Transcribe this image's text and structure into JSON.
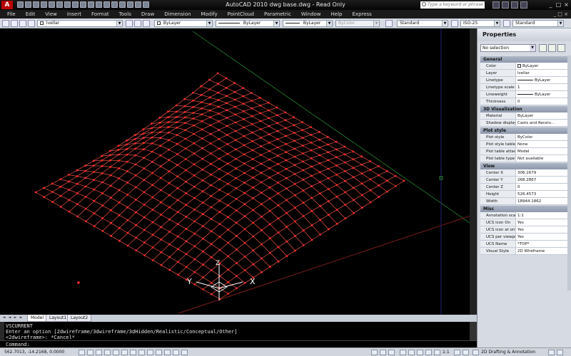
{
  "titlebar": {
    "title": "AutoCAD 2010    dwg base.dwg - Read Only",
    "search_placeholder": "Type a keyword or phrase",
    "app_logo": "A",
    "win_controls": [
      "_",
      "□",
      "×"
    ]
  },
  "menu": {
    "items": [
      "File",
      "Edit",
      "View",
      "Insert",
      "Format",
      "Tools",
      "Draw",
      "Dimension",
      "Modify",
      "PointCloud",
      "Parametric",
      "Window",
      "Help",
      "Express"
    ],
    "mini_controls": "_ □ ×"
  },
  "toolbar": {
    "layer": "lvellar",
    "color": "ByLayer",
    "linetype": "ByLayer",
    "lineweight": "ByLayer",
    "plotstyle": "ByColor",
    "text_style": "Standard",
    "dim_style": "ISO-25",
    "table_style": "Standard"
  },
  "tabs": {
    "nav": [
      "◄",
      "◄",
      "►",
      "►"
    ],
    "items": [
      "Model",
      "Layout1",
      "Layout2"
    ],
    "active": 0
  },
  "command": {
    "lines": [
      "VSCURRENT",
      "Enter an option [2dwireframe/3dwireframe/3dHidden/Realistic/Conceptual/Other]",
      "<2dwireframe>: *Cancel*"
    ],
    "prompt": "Command:"
  },
  "status": {
    "coords": "562.7013, -14.2168, 0.0000",
    "scale": "1:1",
    "workspace": "2D Drafting & Annotation"
  },
  "ucs": {
    "x_label": "X",
    "y_label": "Y",
    "z_label": "Z"
  },
  "properties": {
    "title": "Properties",
    "selection": "No selection",
    "sections": [
      {
        "name": "General",
        "rows": [
          {
            "k": "Color",
            "v": "ByLayer",
            "mark": "swatch"
          },
          {
            "k": "Layer",
            "v": "lvellar"
          },
          {
            "k": "Linetype",
            "v": "ByLayer",
            "mark": "line"
          },
          {
            "k": "Linetype scale",
            "v": "1"
          },
          {
            "k": "Lineweight",
            "v": "ByLayer",
            "mark": "line"
          },
          {
            "k": "Thickness",
            "v": "0"
          }
        ]
      },
      {
        "name": "3D Visualization",
        "rows": [
          {
            "k": "Material",
            "v": "ByLayer"
          },
          {
            "k": "Shadow display",
            "v": "Casts and Receiv..."
          }
        ]
      },
      {
        "name": "Plot style",
        "rows": [
          {
            "k": "Plot style",
            "v": "ByColor"
          },
          {
            "k": "Plot style table",
            "v": "None"
          },
          {
            "k": "Plot table attac...",
            "v": "Model"
          },
          {
            "k": "Plot table type",
            "v": "Not available"
          }
        ]
      },
      {
        "name": "View",
        "rows": [
          {
            "k": "Center X",
            "v": "306.1679"
          },
          {
            "k": "Center Y",
            "v": "268.2867"
          },
          {
            "k": "Center Z",
            "v": "0"
          },
          {
            "k": "Height",
            "v": "526.4573"
          },
          {
            "k": "Width",
            "v": "18944.1862"
          }
        ]
      },
      {
        "name": "Misc",
        "rows": [
          {
            "k": "Annotation scale",
            "v": "1:1"
          },
          {
            "k": "UCS icon On",
            "v": "Yes"
          },
          {
            "k": "UCS icon at origin",
            "v": "Yes"
          },
          {
            "k": "UCS per viewport",
            "v": "Yes"
          },
          {
            "k": "UCS Name",
            "v": "*TOP*"
          },
          {
            "k": "Visual Style",
            "v": "2D Wireframe"
          }
        ]
      }
    ]
  },
  "colors": {
    "mesh": "#e8554a",
    "node": "#ff2a2a",
    "canvas": "#000000"
  }
}
